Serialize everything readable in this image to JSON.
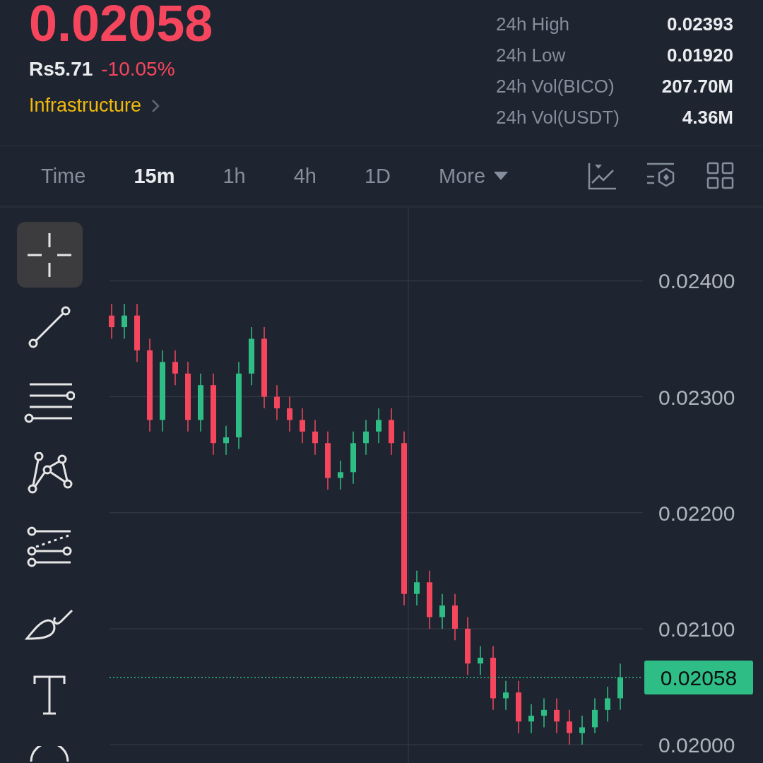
{
  "header": {
    "price": "0.02058",
    "fiat_price": "Rs5.71",
    "change": "-10.05%",
    "category": "Infrastructure",
    "stats": [
      {
        "label": "24h High",
        "value": "0.02393"
      },
      {
        "label": "24h Low",
        "value": "0.01920"
      },
      {
        "label": "24h Vol(BICO)",
        "value": "207.70M"
      },
      {
        "label": "24h Vol(USDT)",
        "value": "4.36M"
      }
    ]
  },
  "intervals": [
    {
      "label": "Time",
      "selected": false
    },
    {
      "label": "15m",
      "selected": true
    },
    {
      "label": "1h",
      "selected": false
    },
    {
      "label": "4h",
      "selected": false
    },
    {
      "label": "1D",
      "selected": false
    }
  ],
  "more": "More",
  "tools": [
    {
      "kind": "crosshair",
      "selected": true
    },
    {
      "kind": "line",
      "selected": false
    },
    {
      "kind": "parallel",
      "selected": false
    },
    {
      "kind": "pattern",
      "selected": false
    },
    {
      "kind": "fib",
      "selected": false
    },
    {
      "kind": "brush",
      "selected": false
    },
    {
      "kind": "text",
      "selected": false
    },
    {
      "kind": "shape",
      "selected": false
    }
  ],
  "chart": {
    "current_price": "0.02058",
    "chart_data": {
      "type": "candlestick",
      "grid": true,
      "ylim": [
        0.01983,
        0.02463
      ],
      "yticks": [
        {
          "value": 0.024,
          "label": "0.02400"
        },
        {
          "value": 0.023,
          "label": "0.02300"
        },
        {
          "value": 0.022,
          "label": "0.02200"
        },
        {
          "value": 0.021,
          "label": "0.02100"
        },
        {
          "value": 0.02,
          "label": "0.02000"
        }
      ],
      "ohlc": [
        [
          0.0237,
          0.0238,
          0.0235,
          0.0236
        ],
        [
          0.0236,
          0.0238,
          0.0235,
          0.0237
        ],
        [
          0.0237,
          0.0238,
          0.0233,
          0.0234
        ],
        [
          0.0234,
          0.0235,
          0.0227,
          0.0228
        ],
        [
          0.0228,
          0.0234,
          0.0227,
          0.0233
        ],
        [
          0.0233,
          0.0234,
          0.0231,
          0.0232
        ],
        [
          0.0232,
          0.0233,
          0.0227,
          0.0228
        ],
        [
          0.0228,
          0.0232,
          0.0227,
          0.0231
        ],
        [
          0.0231,
          0.0232,
          0.0225,
          0.0226
        ],
        [
          0.0226,
          0.02275,
          0.0225,
          0.02265
        ],
        [
          0.02265,
          0.0233,
          0.02255,
          0.0232
        ],
        [
          0.0232,
          0.0236,
          0.0231,
          0.0235
        ],
        [
          0.0235,
          0.0236,
          0.0229,
          0.023
        ],
        [
          0.023,
          0.0231,
          0.0228,
          0.0229
        ],
        [
          0.0229,
          0.023,
          0.0227,
          0.0228
        ],
        [
          0.0228,
          0.0229,
          0.0226,
          0.0227
        ],
        [
          0.0227,
          0.0228,
          0.0225,
          0.0226
        ],
        [
          0.0226,
          0.0227,
          0.0222,
          0.0223
        ],
        [
          0.0223,
          0.02245,
          0.0222,
          0.02235
        ],
        [
          0.02235,
          0.0227,
          0.02225,
          0.0226
        ],
        [
          0.0226,
          0.0228,
          0.0225,
          0.0227
        ],
        [
          0.0227,
          0.0229,
          0.0226,
          0.0228
        ],
        [
          0.0228,
          0.0229,
          0.0225,
          0.0226
        ],
        [
          0.0226,
          0.0227,
          0.0212,
          0.0213
        ],
        [
          0.0213,
          0.0215,
          0.0212,
          0.0214
        ],
        [
          0.0214,
          0.0215,
          0.021,
          0.0211
        ],
        [
          0.0211,
          0.0213,
          0.021,
          0.0212
        ],
        [
          0.0212,
          0.0213,
          0.0209,
          0.021
        ],
        [
          0.021,
          0.0211,
          0.0206,
          0.0207
        ],
        [
          0.0207,
          0.02085,
          0.0206,
          0.02075
        ],
        [
          0.02075,
          0.02085,
          0.0203,
          0.0204
        ],
        [
          0.0204,
          0.02055,
          0.0203,
          0.02045
        ],
        [
          0.02045,
          0.02055,
          0.0201,
          0.0202
        ],
        [
          0.0202,
          0.02035,
          0.0201,
          0.02025
        ],
        [
          0.02025,
          0.0204,
          0.02015,
          0.0203
        ],
        [
          0.0203,
          0.0204,
          0.0201,
          0.0202
        ],
        [
          0.0202,
          0.0203,
          0.02,
          0.0201
        ],
        [
          0.0201,
          0.02025,
          0.02,
          0.02015
        ],
        [
          0.02015,
          0.0204,
          0.0201,
          0.0203
        ],
        [
          0.0203,
          0.0205,
          0.0202,
          0.0204
        ],
        [
          0.0204,
          0.0207,
          0.0203,
          0.02058
        ]
      ]
    }
  }
}
